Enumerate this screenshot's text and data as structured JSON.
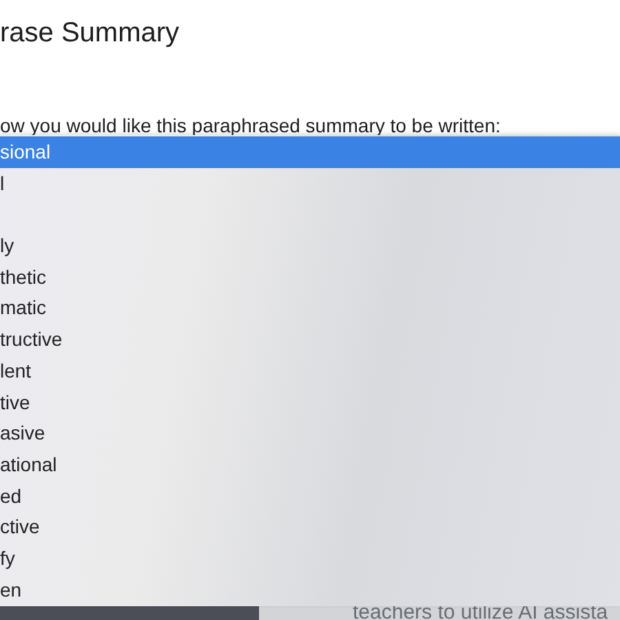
{
  "page": {
    "title": "rase Summary",
    "prompt": "ow you would like this paraphrased summary to be written:"
  },
  "menu": {
    "options": [
      {
        "kind": "option",
        "label": "sional",
        "selected": true
      },
      {
        "kind": "option",
        "label": "l",
        "selected": false
      },
      {
        "kind": "blank"
      },
      {
        "kind": "option",
        "label": "ly",
        "selected": false
      },
      {
        "kind": "option",
        "label": "thetic",
        "selected": false
      },
      {
        "kind": "option",
        "label": "matic",
        "selected": false
      },
      {
        "kind": "option",
        "label": "tructive",
        "selected": false
      },
      {
        "kind": "option",
        "label": "lent",
        "selected": false
      },
      {
        "kind": "option",
        "label": "tive",
        "selected": false
      },
      {
        "kind": "option",
        "label": "asive",
        "selected": false
      },
      {
        "kind": "option",
        "label": "ational",
        "selected": false
      },
      {
        "kind": "option",
        "label": "ed",
        "selected": false
      },
      {
        "kind": "option",
        "label": "ctive",
        "selected": false
      },
      {
        "kind": "option",
        "label": "fy",
        "selected": false
      },
      {
        "kind": "option",
        "label": "en",
        "selected": false
      }
    ]
  },
  "background_text": "teachers to utilize AI assista"
}
